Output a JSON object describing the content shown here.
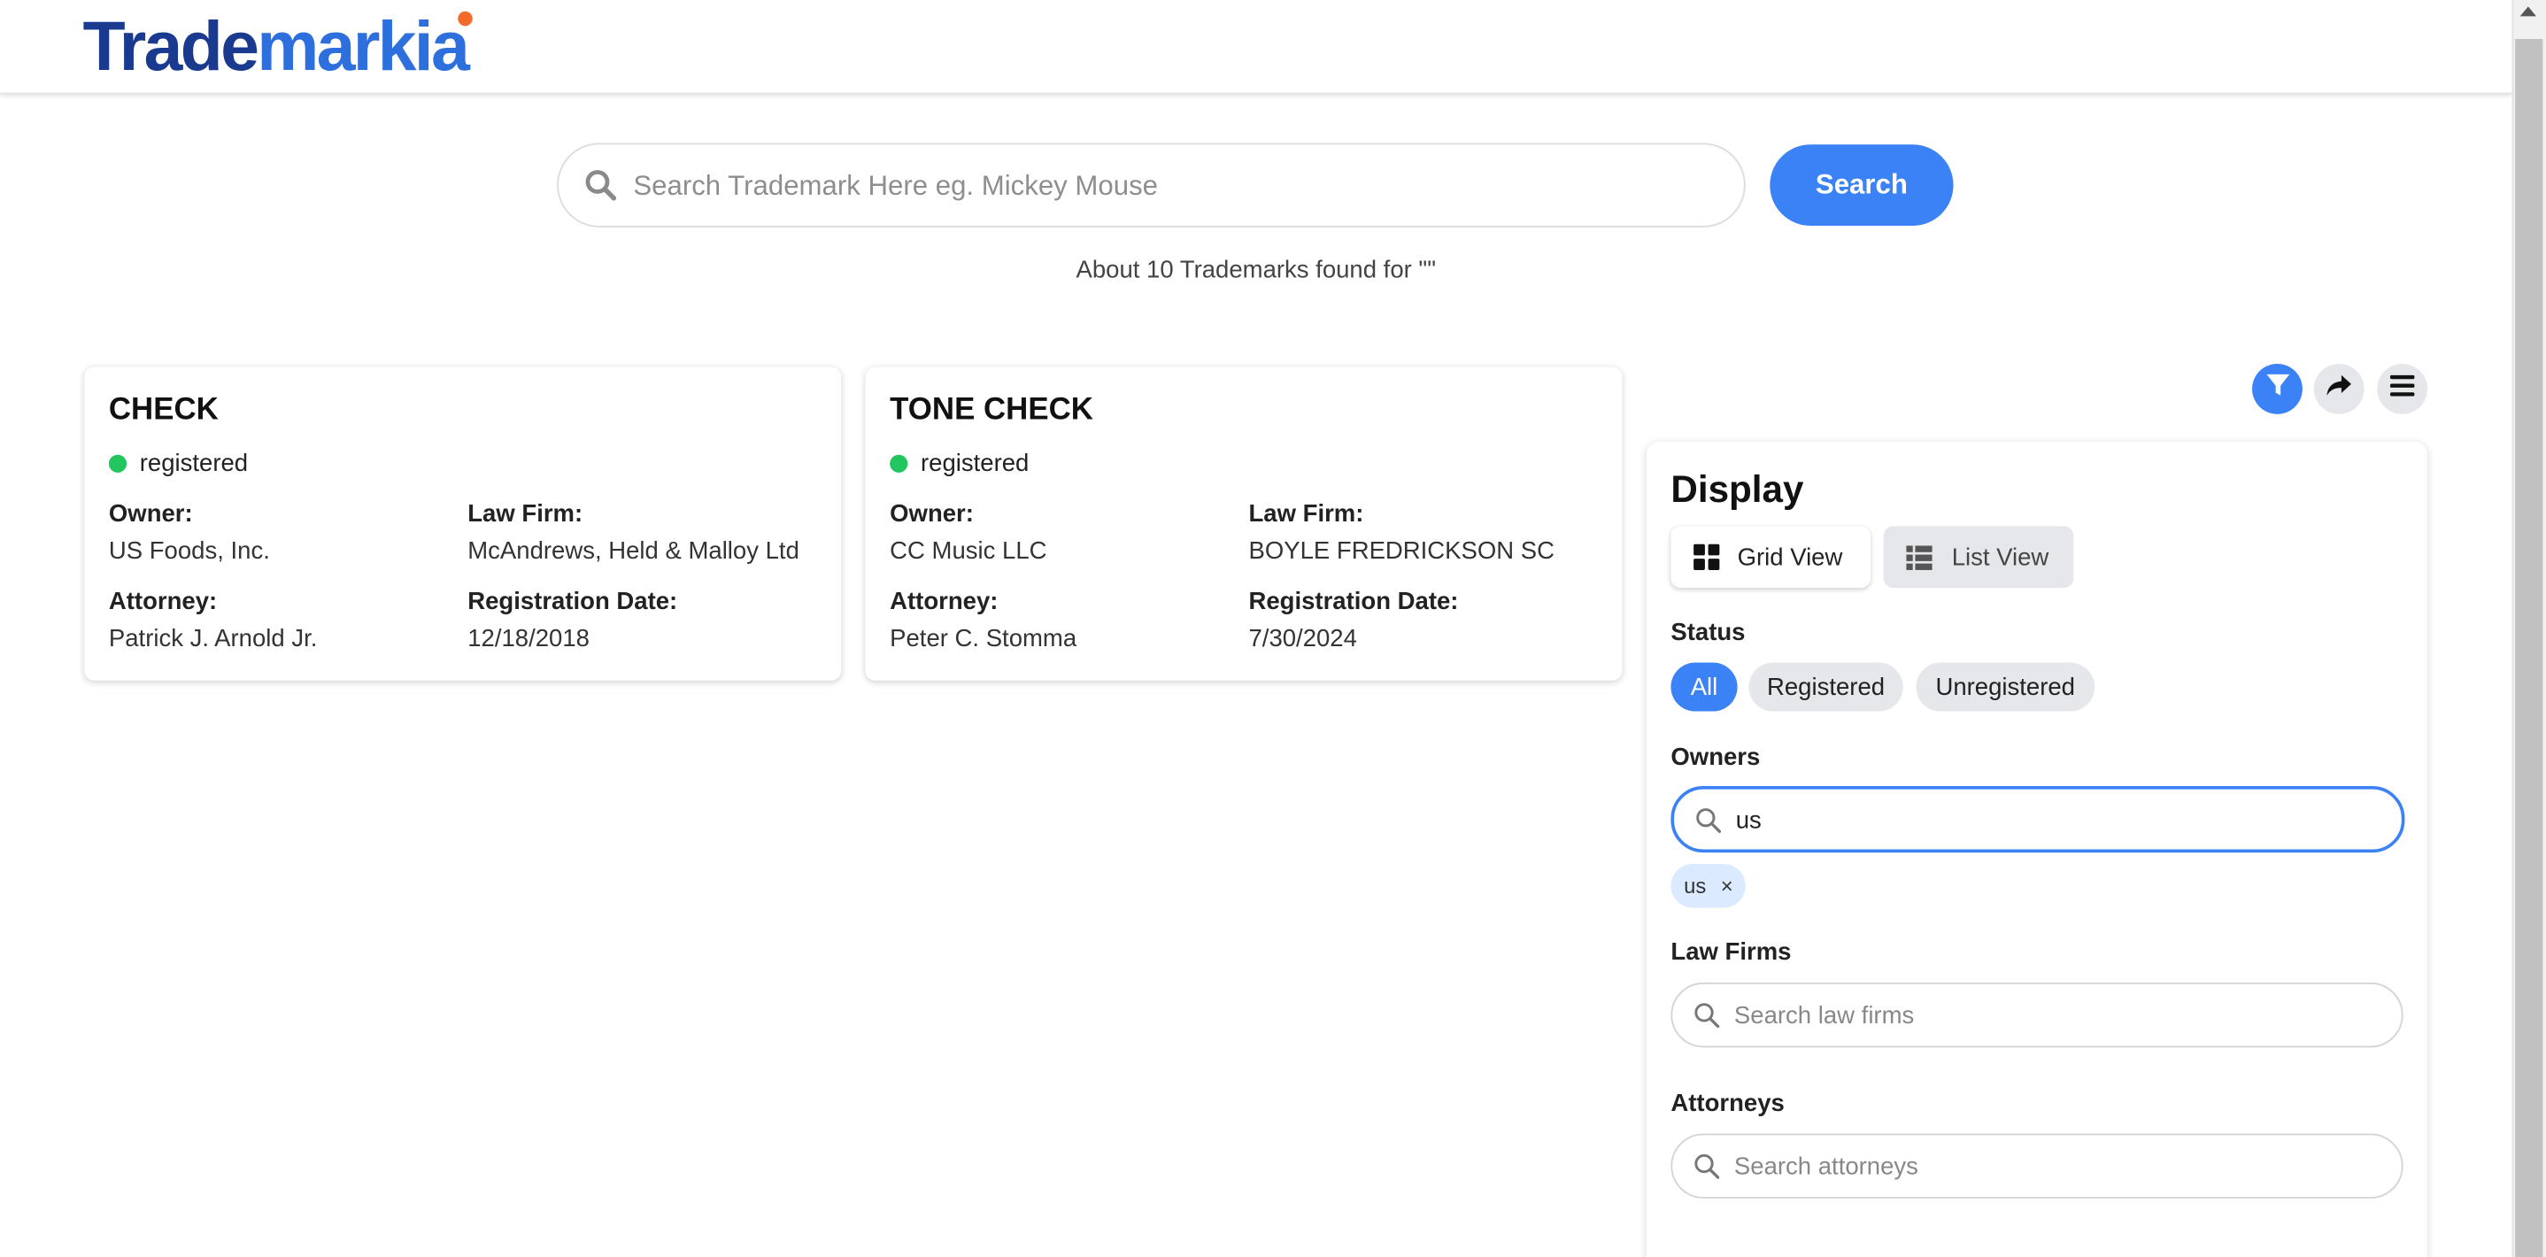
{
  "header": {
    "logo_part1": "Trade",
    "logo_part2": "markia",
    "brand_colors": {
      "primary": "#1a3a8f",
      "accent": "#2d6fdc",
      "dot": "#f26b2b"
    }
  },
  "search": {
    "placeholder": "Search Trademark Here eg. Mickey Mouse",
    "value": "",
    "button_label": "Search",
    "icon": "search-icon"
  },
  "results": {
    "summary": "About 10 Trademarks found for \"\""
  },
  "cards": [
    {
      "title": "CHECK",
      "status": "registered",
      "owner_label": "Owner:",
      "owner": "US Foods, Inc.",
      "law_firm_label": "Law Firm:",
      "law_firm": "McAndrews, Held & Malloy Ltd",
      "attorney_label": "Attorney:",
      "attorney": "Patrick J. Arnold Jr.",
      "reg_date_label": "Registration Date:",
      "reg_date": "12/18/2018"
    },
    {
      "title": "TONE CHECK",
      "status": "registered",
      "owner_label": "Owner:",
      "owner": "CC Music LLC",
      "law_firm_label": "Law Firm:",
      "law_firm": "BOYLE FREDRICKSON SC",
      "attorney_label": "Attorney:",
      "attorney": "Peter C. Stomma",
      "reg_date_label": "Registration Date:",
      "reg_date": "7/30/2024"
    }
  ],
  "toolbar": {
    "filter_icon": "filter-icon",
    "share_icon": "share-icon",
    "menu_icon": "menu-icon"
  },
  "panel": {
    "heading": "Display",
    "grid_view_label": "Grid View",
    "list_view_label": "List View",
    "status_label": "Status",
    "status_options": [
      "All",
      "Registered",
      "Unregistered"
    ],
    "owners_label": "Owners",
    "owners_value": "us",
    "owners_tag": "us",
    "owners_tag_remove": "×",
    "law_firms_label": "Law Firms",
    "law_firms_placeholder": "Search law firms",
    "attorneys_label": "Attorneys",
    "attorneys_placeholder": "Search attorneys"
  }
}
